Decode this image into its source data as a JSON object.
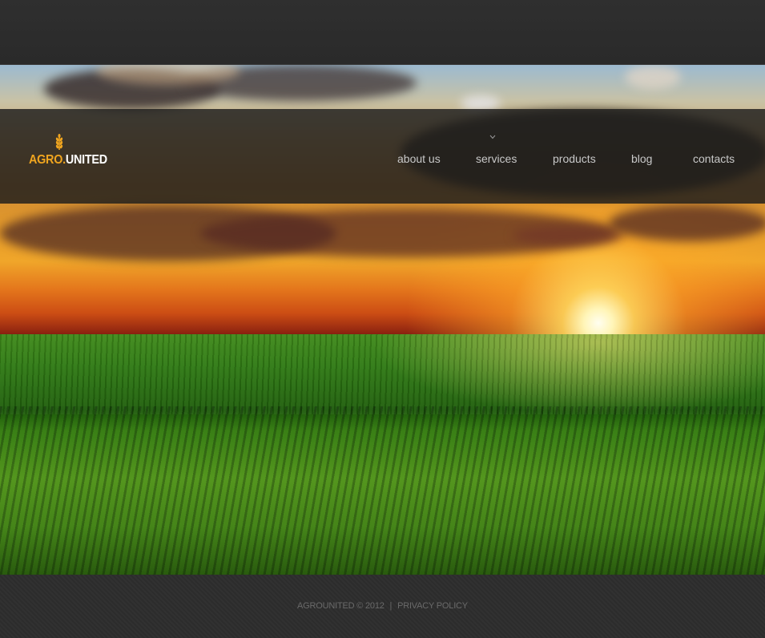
{
  "brand": {
    "logo_part1": "AGRO.",
    "logo_part2": "UNITED",
    "accent_color": "#f0a51f",
    "icon": "wheat-icon"
  },
  "nav": {
    "items": [
      {
        "label": "about us"
      },
      {
        "label": "services"
      },
      {
        "label": "products"
      },
      {
        "label": "blog"
      },
      {
        "label": "contacts"
      }
    ],
    "active_indicator_icon": "chevron-down-icon"
  },
  "hero": {
    "image": "sunset over green field"
  },
  "footer": {
    "copyright": "AGROUNITED © 2012",
    "separator": "|",
    "privacy_link": "PRIVACY POLICY"
  },
  "colors": {
    "background": "#2d2d2d",
    "header_band": "#1c1c1c",
    "nav_text": "#c8c8c8",
    "footer_text": "#6a6a6a"
  }
}
